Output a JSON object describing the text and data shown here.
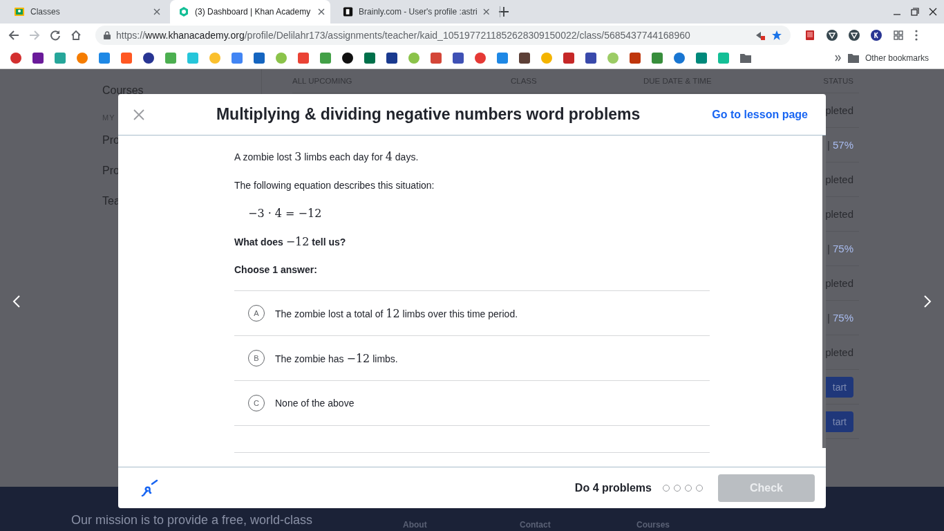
{
  "browser": {
    "tabs": [
      {
        "title": "Classes",
        "selected": false
      },
      {
        "title": "(3) Dashboard | Khan Academy",
        "selected": true
      },
      {
        "title": "Brainly.com - User's profile :astri",
        "selected": false
      }
    ],
    "address": {
      "scheme": "https://",
      "host": "www.khanacademy.org",
      "path": "/profile/Delilahr173/assignments/teacher/kaid_1051977211852628309150022/class/5685437744168960"
    },
    "other_bookmarks": "Other bookmarks"
  },
  "background": {
    "sidebar": [
      {
        "kind": "link",
        "text": "Courses"
      },
      {
        "kind": "heading",
        "text": "MY"
      },
      {
        "kind": "link",
        "text": "Pro"
      },
      {
        "kind": "link",
        "text": "Pro"
      },
      {
        "kind": "link",
        "text": "Tea"
      }
    ],
    "columns": [
      "ALL UPCOMING",
      "CLASS",
      "DUE DATE & TIME",
      "STATUS"
    ],
    "statuses": [
      {
        "kind": "text",
        "text": "pleted"
      },
      {
        "kind": "progress",
        "bar": "|",
        "text": "57%"
      },
      {
        "kind": "text",
        "text": "pleted"
      },
      {
        "kind": "text",
        "text": "pleted"
      },
      {
        "kind": "progress",
        "bar": "|",
        "text": "75%"
      },
      {
        "kind": "text",
        "text": "pleted"
      },
      {
        "kind": "progress",
        "bar": "|",
        "text": "75%"
      },
      {
        "kind": "text",
        "text": "pleted"
      },
      {
        "kind": "button",
        "text": "tart"
      },
      {
        "kind": "button",
        "text": "tart"
      }
    ],
    "footer": {
      "mission": "Our mission is to provide a free, world-class",
      "links": [
        "About",
        "Contact",
        "Courses"
      ]
    }
  },
  "modal": {
    "title": "Multiplying & dividing negative numbers word problems",
    "lesson_link": "Go to lesson page",
    "question": [
      {
        "kind": "plain",
        "parts": [
          {
            "kind": "text",
            "text": "A zombie lost "
          },
          {
            "kind": "math",
            "text": "3"
          },
          {
            "kind": "text",
            "text": " limbs each day for "
          },
          {
            "kind": "math",
            "text": "4"
          },
          {
            "kind": "text",
            "text": " days."
          }
        ]
      },
      {
        "kind": "plain",
        "parts": [
          {
            "kind": "text",
            "text": "The following equation describes this situation:"
          }
        ]
      },
      {
        "kind": "equation",
        "parts": [
          {
            "kind": "math",
            "text": "−3 · 4 = −12"
          }
        ]
      },
      {
        "kind": "strong",
        "parts": [
          {
            "kind": "text",
            "text": "What does "
          },
          {
            "kind": "math",
            "text": "−12"
          },
          {
            "kind": "text",
            "text": " tell us?"
          }
        ]
      },
      {
        "kind": "strong",
        "parts": [
          {
            "kind": "text",
            "text": "Choose 1 answer:"
          }
        ]
      }
    ],
    "choices": [
      {
        "letter": "A",
        "selected": false,
        "parts": [
          {
            "kind": "text",
            "text": "The zombie lost a total of "
          },
          {
            "kind": "math",
            "text": "12"
          },
          {
            "kind": "text",
            "text": " limbs over this time period."
          }
        ]
      },
      {
        "letter": "B",
        "selected": false,
        "parts": [
          {
            "kind": "text",
            "text": "The zombie has "
          },
          {
            "kind": "math",
            "text": "−12"
          },
          {
            "kind": "text",
            "text": " limbs."
          }
        ]
      },
      {
        "letter": "C",
        "selected": false,
        "parts": [
          {
            "kind": "text",
            "text": "None of the above"
          }
        ]
      }
    ],
    "goal": "Do 4 problems",
    "problems": [
      {
        "done": false
      },
      {
        "done": false
      },
      {
        "done": false
      },
      {
        "done": false
      }
    ],
    "check": {
      "label": "Check",
      "disabled": true
    }
  }
}
